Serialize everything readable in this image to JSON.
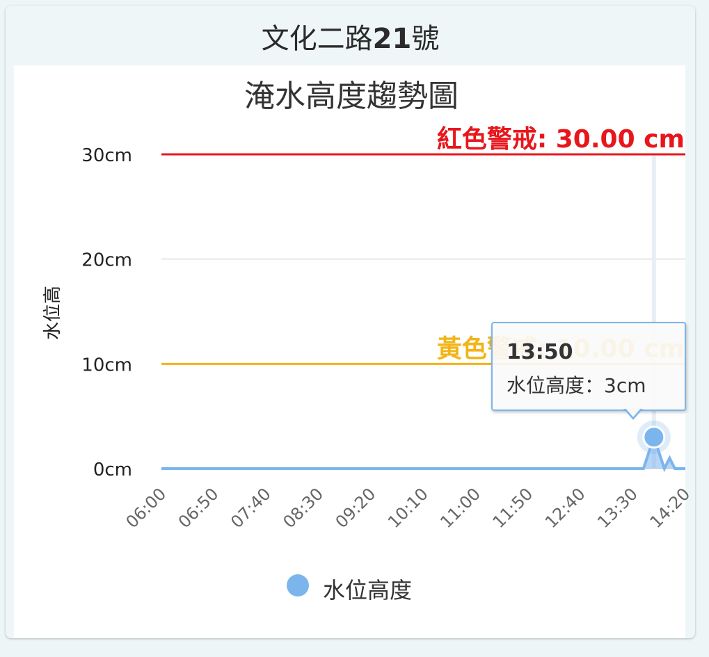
{
  "card": {
    "title_prefix": "文化二路",
    "title_number": "21",
    "title_suffix": "號"
  },
  "chart_data": {
    "type": "area",
    "title": "淹水高度趨勢圖",
    "ylabel": "水位高",
    "y_ticks": [
      "0cm",
      "10cm",
      "20cm",
      "30cm"
    ],
    "ylim": [
      0,
      30
    ],
    "x_ticks": [
      "06:00",
      "06:50",
      "07:40",
      "08:30",
      "09:20",
      "10:10",
      "11:00",
      "11:50",
      "12:40",
      "13:30",
      "14:20"
    ],
    "series": [
      {
        "name": "水位高度",
        "color": "#7cb5ec",
        "points": [
          [
            "06:00",
            0
          ],
          [
            "13:40",
            0
          ],
          [
            "13:50",
            3
          ],
          [
            "14:00",
            0
          ],
          [
            "14:05",
            1
          ],
          [
            "14:10",
            0
          ],
          [
            "14:20",
            0
          ]
        ]
      }
    ],
    "plot_lines": [
      {
        "label": "紅色警戒: 30.00 cm",
        "value": 30,
        "color": "#e8161b"
      },
      {
        "label": "黃色警戒: 10.00 cm",
        "value": 10,
        "color": "#f2b417"
      }
    ],
    "tooltip": {
      "time": "13:50",
      "text": "水位高度：3cm"
    },
    "legend": "bottom-center"
  }
}
